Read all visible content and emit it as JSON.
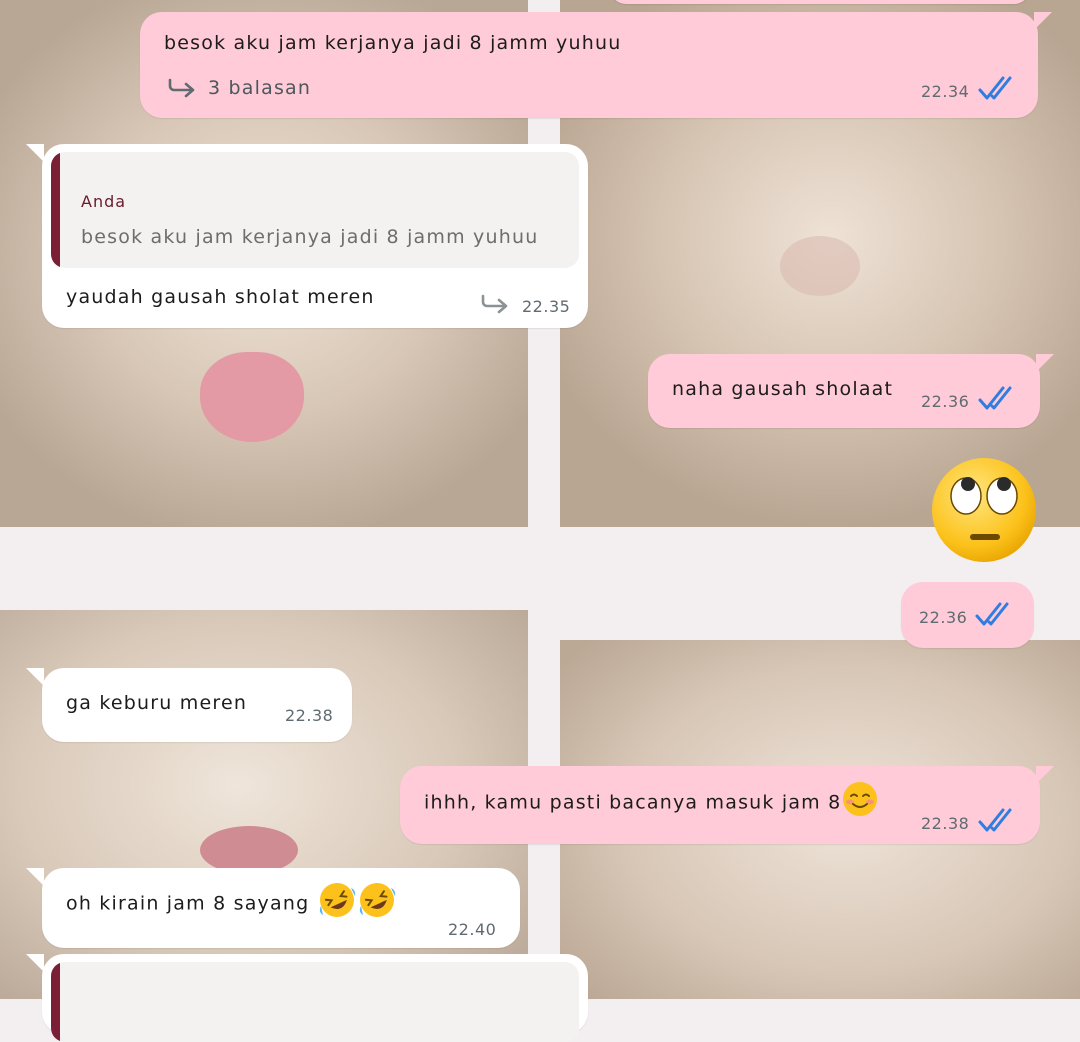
{
  "chat": {
    "messages": [
      {
        "id": "m1",
        "direction": "outgoing",
        "text": "besok aku jam kerjanya jadi 8 jamm yuhuu",
        "replies_label": "3 balasan",
        "time": "22.34",
        "status": "read"
      },
      {
        "id": "m2",
        "direction": "incoming",
        "quote_author": "Anda",
        "quote_text": "besok aku jam kerjanya jadi 8 jamm yuhuu",
        "text": "yaudah gausah sholat meren",
        "time": "22.35"
      },
      {
        "id": "m3",
        "direction": "outgoing",
        "text": "naha gausah sholaat",
        "time": "22.36",
        "status": "read"
      },
      {
        "id": "m4",
        "direction": "outgoing",
        "emoji": "face-with-rolling-eyes",
        "time": "22.36",
        "status": "read"
      },
      {
        "id": "m5",
        "direction": "incoming",
        "text": "ga keburu meren",
        "time": "22.38"
      },
      {
        "id": "m6",
        "direction": "outgoing",
        "text": "ihhh, kamu pasti bacanya masuk jam 8",
        "emoji": "smiling-face",
        "time": "22.38",
        "status": "read"
      },
      {
        "id": "m7",
        "direction": "incoming",
        "text": "oh kirain jam 8 sayang",
        "emoji": "rolling-on-the-floor-laughing x2",
        "time": "22.40"
      }
    ]
  },
  "colors": {
    "outgoing_bubble": "#ffcbd8",
    "incoming_bubble": "#ffffff",
    "read_ticks": "#2f7de1",
    "quote_bar": "#7a1f35"
  }
}
